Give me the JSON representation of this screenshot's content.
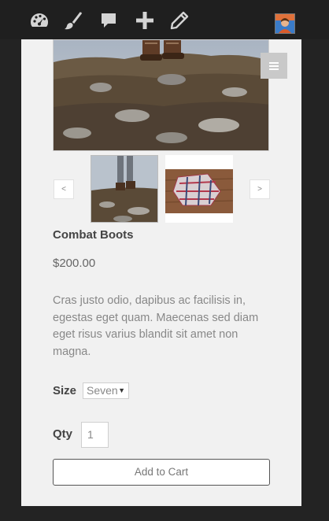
{
  "toolbar": {
    "icons": [
      "dashboard-icon",
      "brush-icon",
      "comment-icon",
      "plus-icon",
      "pencil-icon"
    ]
  },
  "gallery": {
    "prev_label": "<",
    "next_label": ">",
    "thumbnails": [
      "boots-on-rocks",
      "flannel-shirt-on-deck"
    ]
  },
  "product": {
    "title": "Combat Boots",
    "price": "$200.00",
    "description": "Cras justo odio, dapibus ac facilisis in, egestas eget quam. Maecenas sed diam eget risus varius blandit sit amet non magna."
  },
  "options": {
    "size_label": "Size",
    "size_value": "Seven",
    "qty_label": "Qty",
    "qty_value": "1"
  },
  "cart": {
    "button_label": "Add to Cart"
  },
  "colors": {
    "background": "#232323",
    "panel": "#f1f1f1",
    "toolbar": "#1f1f1f"
  }
}
